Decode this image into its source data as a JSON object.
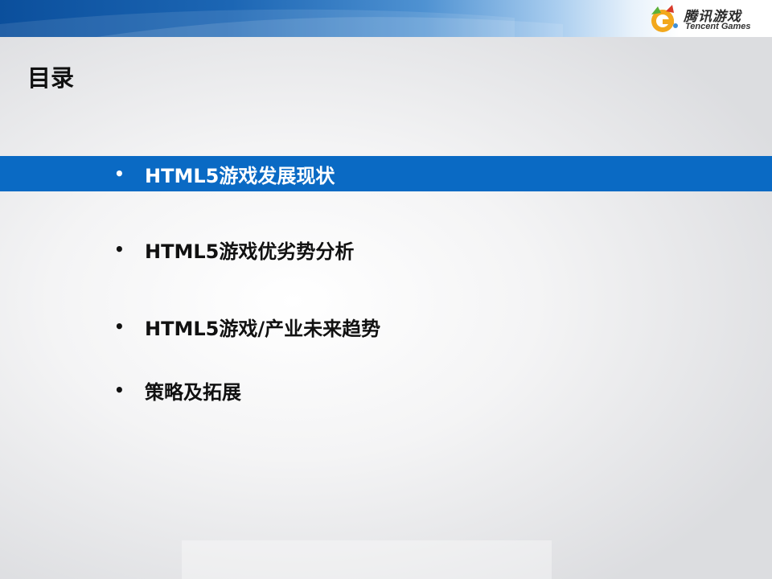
{
  "header": {
    "logo": {
      "name_cn": "腾讯游戏",
      "name_en": "Tencent Games",
      "icon": "tencent-games-logo-icon"
    },
    "colors": {
      "banner_dark": "#0b4f9c",
      "banner_light": "#a9cdef",
      "highlight": "#0a6ac4"
    }
  },
  "slide": {
    "title": "目录",
    "agenda": [
      {
        "label": "HTML5游戏发展现状",
        "active": true
      },
      {
        "label": "HTML5游戏优劣势分析",
        "active": false
      },
      {
        "label": "HTML5游戏/产业未来趋势",
        "active": false
      },
      {
        "label": "策略及拓展",
        "active": false
      }
    ],
    "bullet": "•"
  }
}
